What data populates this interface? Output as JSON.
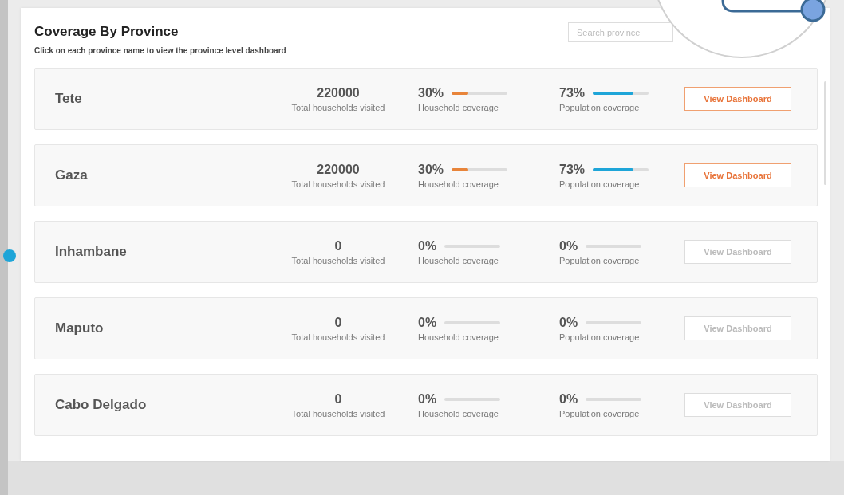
{
  "panel": {
    "title": "Coverage By Province",
    "subtitle": "Click on each province name to view the province level dashboard",
    "search": {
      "placeholder": "Search province"
    }
  },
  "provinces": [
    {
      "name": "Tete",
      "total": "220000",
      "total_label": "Total households visited",
      "household": {
        "reading": "30%",
        "label": "Household coverage",
        "level": 0.3
      },
      "population": {
        "reading": "73%",
        "label": "Population coverage",
        "level": 0.73
      },
      "button": "View Dashboard",
      "disabled": false
    },
    {
      "name": "Gaza",
      "total": "220000",
      "total_label": "Total households visited",
      "household": {
        "reading": "30%",
        "label": "Household coverage",
        "level": 0.3
      },
      "population": {
        "reading": "73%",
        "label": "Population coverage",
        "level": 0.73
      },
      "button": "View Dashboard",
      "disabled": false
    },
    {
      "name": "Inhambane",
      "total": "0",
      "total_label": "Total households visited",
      "household": {
        "reading": "0%",
        "label": "Household coverage",
        "level": 0
      },
      "population": {
        "reading": "0%",
        "label": "Population coverage",
        "level": 0
      },
      "button": "View Dashboard",
      "disabled": true
    },
    {
      "name": "Maputo",
      "total": "0",
      "total_label": "Total households visited",
      "household": {
        "reading": "0%",
        "label": "Household coverage",
        "level": 0
      },
      "population": {
        "reading": "0%",
        "label": "Population coverage",
        "level": 0
      },
      "button": "View Dashboard",
      "disabled": true
    },
    {
      "name": "Cabo Delgado",
      "total": "0",
      "total_label": "Total households visited",
      "household": {
        "reading": "0%",
        "label": "Household coverage",
        "level": 0
      },
      "population": {
        "reading": "0%",
        "label": "Population coverage",
        "level": 0
      },
      "button": "View Dashboard",
      "disabled": true
    }
  ]
}
